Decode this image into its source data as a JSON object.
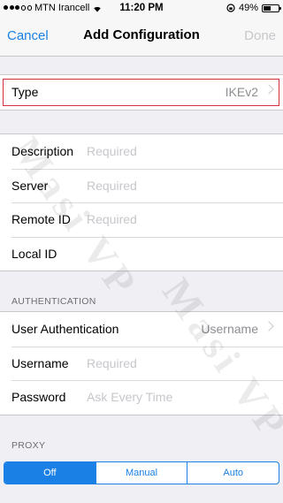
{
  "status": {
    "carrier": "MTN Irancell",
    "time": "11:20 PM",
    "battery": "49%",
    "battery_level": 0.49
  },
  "nav": {
    "cancel": "Cancel",
    "title": "Add Configuration",
    "done": "Done"
  },
  "type_row": {
    "label": "Type",
    "value": "IKEv2"
  },
  "fields": [
    {
      "label": "Description",
      "placeholder": "Required"
    },
    {
      "label": "Server",
      "placeholder": "Required"
    },
    {
      "label": "Remote ID",
      "placeholder": "Required"
    },
    {
      "label": "Local ID",
      "placeholder": ""
    }
  ],
  "authentication": {
    "header": "AUTHENTICATION",
    "user_auth": {
      "label": "User Authentication",
      "value": "Username"
    },
    "username": {
      "label": "Username",
      "placeholder": "Required"
    },
    "password": {
      "label": "Password",
      "placeholder": "Ask Every Time"
    }
  },
  "proxy": {
    "header": "PROXY",
    "options": [
      "Off",
      "Manual",
      "Auto"
    ],
    "selected": "Off"
  },
  "watermark": {
    "text": "Masi VP"
  },
  "colors": {
    "accent": "#1a80e5",
    "highlight_border": "#d0313b",
    "background": "#efeff4"
  }
}
